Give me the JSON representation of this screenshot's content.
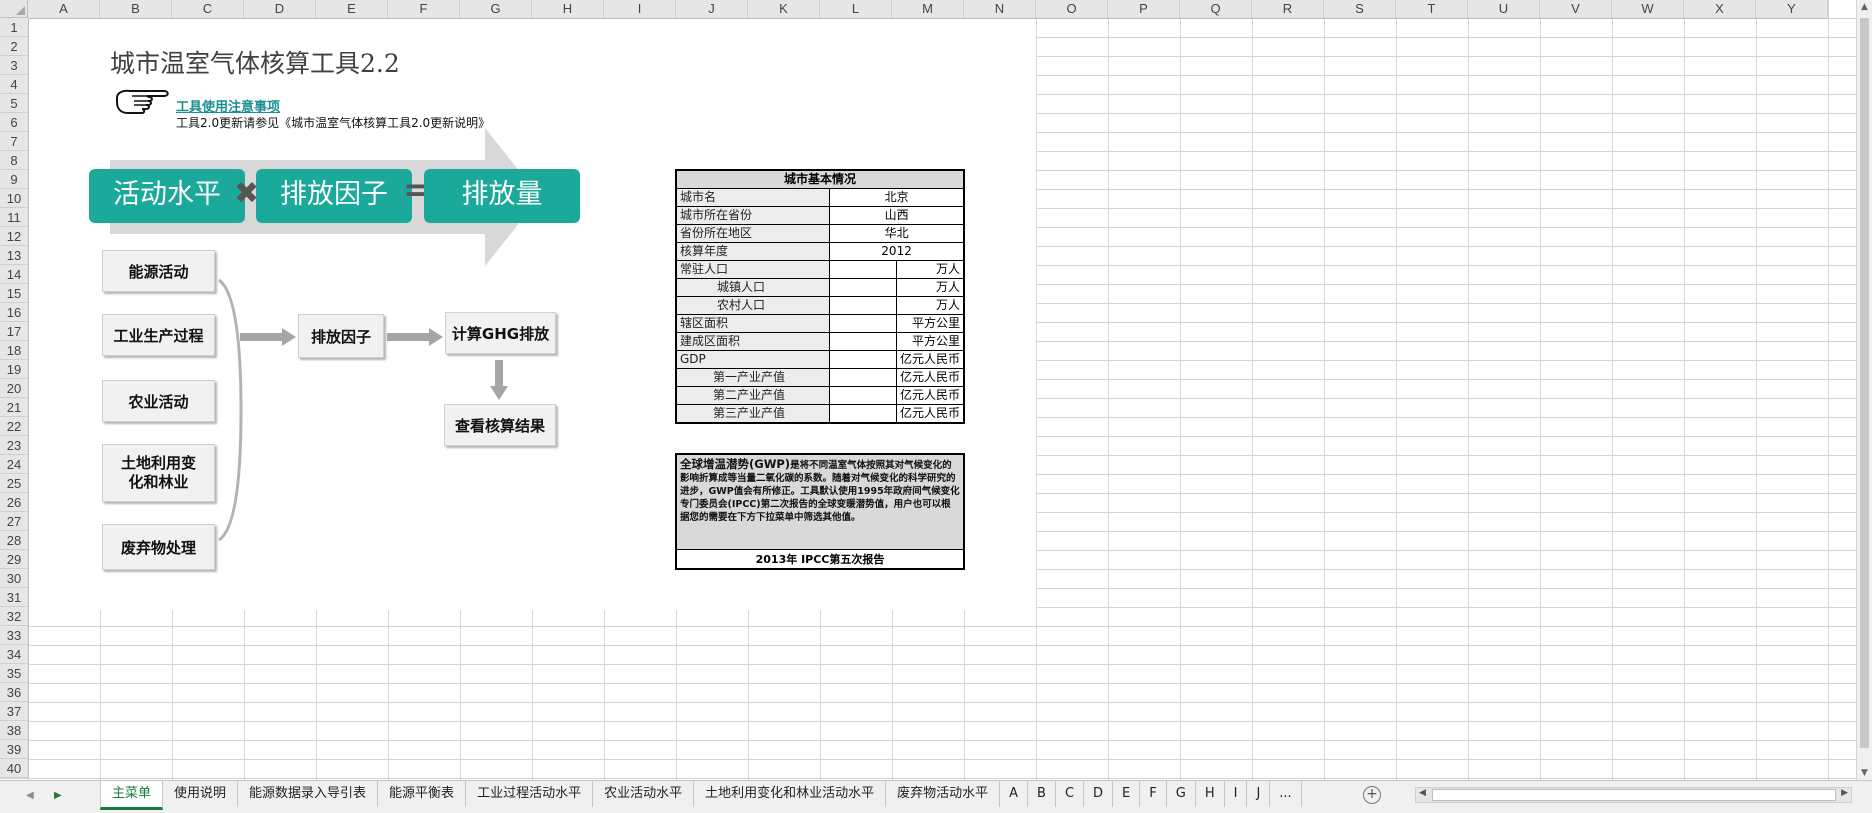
{
  "columns": [
    "A",
    "B",
    "C",
    "D",
    "E",
    "F",
    "G",
    "H",
    "I",
    "J",
    "K",
    "L",
    "M",
    "N",
    "O",
    "P",
    "Q",
    "R",
    "S",
    "T",
    "U",
    "V",
    "W",
    "X",
    "Y"
  ],
  "rows": [
    "1",
    "2",
    "3",
    "4",
    "5",
    "6",
    "7",
    "8",
    "9",
    "10",
    "11",
    "12",
    "13",
    "14",
    "15",
    "16",
    "17",
    "18",
    "19",
    "20",
    "21",
    "22",
    "23",
    "24",
    "25",
    "26",
    "27",
    "28",
    "29",
    "30",
    "31",
    "32",
    "33",
    "34",
    "35",
    "36",
    "37",
    "38",
    "39",
    "40"
  ],
  "title": "城市温室气体核算工具2.2",
  "notice_link": "工具使用注意事项",
  "update_note": "工具2.0更新请参见《城市温室气体核算工具2.0更新说明》",
  "formula": {
    "activity": "活动水平",
    "factor": "排放因子",
    "emission": "排放量",
    "times": "✖",
    "equals": "="
  },
  "buttons": {
    "energy": "能源活动",
    "industry": "工业生产过程",
    "agriculture": "农业活动",
    "landuse": "土地利用变化和林业",
    "waste": "废弃物处理",
    "factor": "排放因子",
    "calc": "计算GHG排放",
    "results": "查看核算结果"
  },
  "city_info": {
    "header": "城市基本情况",
    "rows": [
      {
        "label": "城市名",
        "value": "北京",
        "unit": ""
      },
      {
        "label": "城市所在省份",
        "value": "山西",
        "unit": ""
      },
      {
        "label": "省份所在地区",
        "value": "华北",
        "unit": ""
      },
      {
        "label": "核算年度",
        "value": "2012",
        "unit": ""
      },
      {
        "label": "常驻人口",
        "value": "",
        "unit": "万人"
      },
      {
        "label": "城镇人口",
        "value": "",
        "unit": "万人"
      },
      {
        "label": "农村人口",
        "value": "",
        "unit": "万人"
      },
      {
        "label": "辖区面积",
        "value": "",
        "unit": "平方公里"
      },
      {
        "label": "建成区面积",
        "value": "",
        "unit": "平方公里"
      },
      {
        "label": "GDP",
        "value": "",
        "unit": "亿元人民币"
      },
      {
        "label": "第一产业产值",
        "value": "",
        "unit": "亿元人民币"
      },
      {
        "label": "第二产业产值",
        "value": "",
        "unit": "亿元人民币"
      },
      {
        "label": "第三产业产值",
        "value": "",
        "unit": "亿元人民币"
      }
    ]
  },
  "gwp": {
    "lead": "全球增温潜势(GWP)",
    "text": "是将不同温室气体按照其对气候变化的影响折算成等当量二氧化碳的系数。随着对气候变化的科学研究的进步，GWP值会有所修正。工具默认使用1995年政府间气候变化专门委员会(IPCC)第二次报告的全球变暖潜势值，用户也可以根据您的需要在下方下拉菜单中筛选其他值。",
    "selected": "2013年 IPCC第五次报告"
  },
  "sheet_tabs": [
    "主菜单",
    "使用说明",
    "能源数据录入导引表",
    "能源平衡表",
    "工业过程活动水平",
    "农业活动水平",
    "土地利用变化和林业活动水平",
    "废弃物活动水平",
    "A",
    "B",
    "C",
    "D",
    "E",
    "F",
    "G",
    "H",
    "I",
    "J",
    "..."
  ],
  "active_tab": "主菜单",
  "colors": {
    "teal": "#1aa99a",
    "link": "#1a8f92",
    "active_tab": "#1b7a3c"
  }
}
